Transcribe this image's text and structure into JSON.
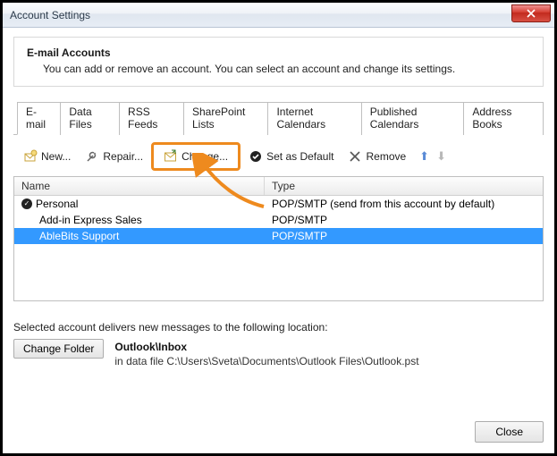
{
  "window": {
    "title": "Account Settings"
  },
  "header": {
    "title": "E-mail Accounts",
    "subtitle": "You can add or remove an account. You can select an account and change its settings."
  },
  "tabs": [
    {
      "label": "E-mail",
      "active": true
    },
    {
      "label": "Data Files",
      "active": false
    },
    {
      "label": "RSS Feeds",
      "active": false
    },
    {
      "label": "SharePoint Lists",
      "active": false
    },
    {
      "label": "Internet Calendars",
      "active": false
    },
    {
      "label": "Published Calendars",
      "active": false
    },
    {
      "label": "Address Books",
      "active": false
    }
  ],
  "toolbar": {
    "new": "New...",
    "repair": "Repair...",
    "change": "Change...",
    "setdefault": "Set as Default",
    "remove": "Remove"
  },
  "list": {
    "columns": {
      "name": "Name",
      "type": "Type"
    },
    "rows": [
      {
        "name": "Personal",
        "type": "POP/SMTP (send from this account by default)",
        "default": true,
        "selected": false
      },
      {
        "name": "Add-in Express Sales",
        "type": "POP/SMTP",
        "default": false,
        "selected": false
      },
      {
        "name": "AbleBits Support",
        "type": "POP/SMTP",
        "default": false,
        "selected": true
      }
    ]
  },
  "delivery": {
    "intro": "Selected account delivers new messages to the following location:",
    "change_folder": "Change Folder",
    "location": "Outlook\\Inbox",
    "datafile": "in data file C:\\Users\\Sveta\\Documents\\Outlook Files\\Outlook.pst"
  },
  "footer": {
    "close": "Close"
  }
}
